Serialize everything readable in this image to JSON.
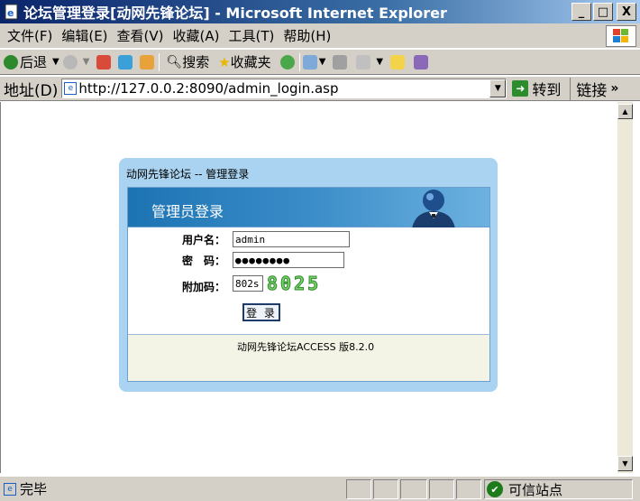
{
  "window": {
    "title": "论坛管理登录[动网先锋论坛] - Microsoft Internet Explorer",
    "minimize": "_",
    "maximize": "□",
    "close": "X"
  },
  "menu": [
    "文件(F)",
    "编辑(E)",
    "查看(V)",
    "收藏(A)",
    "工具(T)",
    "帮助(H)"
  ],
  "toolbar": {
    "back": "后退",
    "search": "搜索",
    "favorites": "收藏夹"
  },
  "address": {
    "label": "地址(D)",
    "url": "http://127.0.0.2:8090/admin_login.asp",
    "go": "转到",
    "links": "链接",
    "more": "»"
  },
  "panel": {
    "title": "动网先锋论坛 -- 管理登录",
    "header": "管理员登录",
    "username_label": "用户名：",
    "username_value": "admin",
    "password_label": "密　码：",
    "password_value": "●●●●●●●●",
    "captcha_label": "附加码：",
    "captcha_value": "802s",
    "captcha_image_text": "8025",
    "login_button": "登 录",
    "version": "动网先锋论坛ACCESS 版8.2.0"
  },
  "status": {
    "text": "完毕",
    "zone": "可信站点"
  }
}
